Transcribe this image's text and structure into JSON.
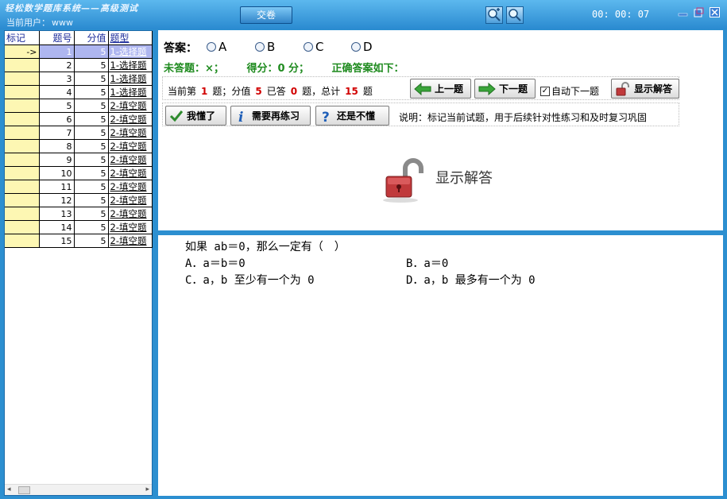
{
  "header": {
    "app_title": "轻松数学题库系统——高级测试",
    "user_label": "当前用户：",
    "user_name": "www",
    "submit_label": "交卷",
    "timer": "00: 00: 07"
  },
  "question_list": {
    "columns": [
      "标记",
      "题号",
      "分值",
      "题型"
    ],
    "rows": [
      {
        "mark": "->",
        "num": "1",
        "score": "5",
        "type": "1-选择题"
      },
      {
        "mark": "",
        "num": "2",
        "score": "5",
        "type": "1-选择题"
      },
      {
        "mark": "",
        "num": "3",
        "score": "5",
        "type": "1-选择题"
      },
      {
        "mark": "",
        "num": "4",
        "score": "5",
        "type": "1-选择题"
      },
      {
        "mark": "",
        "num": "5",
        "score": "5",
        "type": "2-填空题"
      },
      {
        "mark": "",
        "num": "6",
        "score": "5",
        "type": "2-填空题"
      },
      {
        "mark": "",
        "num": "7",
        "score": "5",
        "type": "2-填空题"
      },
      {
        "mark": "",
        "num": "8",
        "score": "5",
        "type": "2-填空题"
      },
      {
        "mark": "",
        "num": "9",
        "score": "5",
        "type": "2-填空题"
      },
      {
        "mark": "",
        "num": "10",
        "score": "5",
        "type": "2-填空题"
      },
      {
        "mark": "",
        "num": "11",
        "score": "5",
        "type": "2-填空题"
      },
      {
        "mark": "",
        "num": "12",
        "score": "5",
        "type": "2-填空题"
      },
      {
        "mark": "",
        "num": "13",
        "score": "5",
        "type": "2-填空题"
      },
      {
        "mark": "",
        "num": "14",
        "score": "5",
        "type": "2-填空题"
      },
      {
        "mark": "",
        "num": "15",
        "score": "5",
        "type": "2-填空题"
      }
    ]
  },
  "answer": {
    "label": "答案：",
    "options": [
      "A",
      "B",
      "C",
      "D"
    ]
  },
  "status": {
    "unanswered": "未答题：×；",
    "score": "得分：0 分；",
    "correct": "正确答案如下："
  },
  "info": {
    "current_prefix": "当前第",
    "current_num": "1",
    "score_prefix": "题；分值",
    "score_val": "5",
    "answered_prefix": "已答",
    "answered_val": "0",
    "total_prefix": "题，总计",
    "total_val": "15",
    "total_suffix": "题"
  },
  "buttons": {
    "prev": "上一题",
    "next": "下一题",
    "auto_next": "自动下一题",
    "show_answer": "显示解答",
    "got_it": "我懂了",
    "practice_again": "需要再练习",
    "still_confused": "还是不懂"
  },
  "help_text": "说明：标记当前试题，用于后续针对性练习和及时复习巩固",
  "show_answer_big": "显示解答",
  "question": {
    "stem": "如果 ab＝0，那么一定有（　）",
    "option_a": "A．a＝b＝0",
    "option_b": "B．a＝0",
    "option_c": "C．a，b 至少有一个为 0",
    "option_d": "D．a，b 最多有一个为 0"
  },
  "colors": {
    "accent": "#2c8fd0",
    "status_green": "#1f8b1f",
    "highlight_red": "#d10000",
    "mark_yellow": "#fdf7b3",
    "selected_row": "#aeb6f0"
  }
}
